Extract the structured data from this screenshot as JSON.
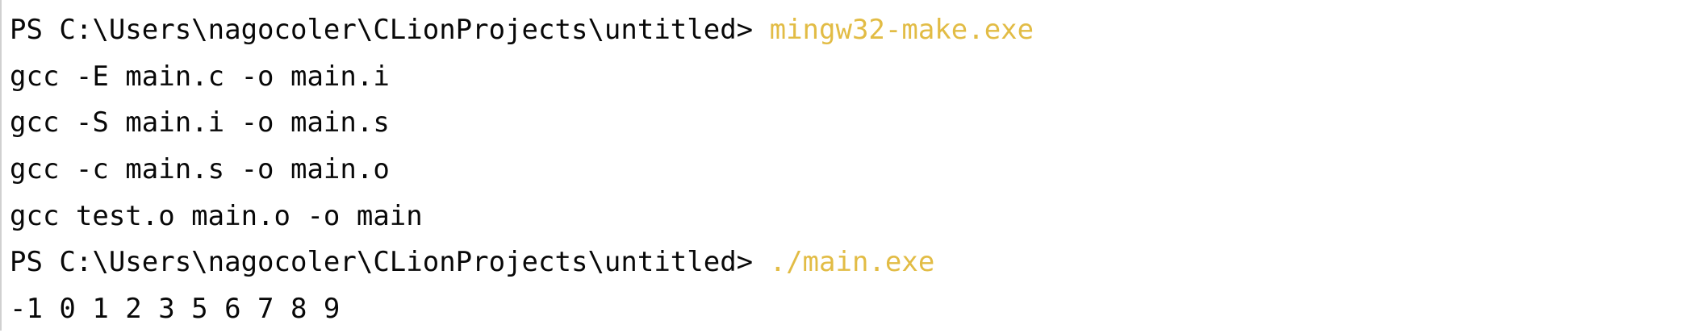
{
  "terminal": {
    "accent_color": "#e2bc45",
    "lines": [
      {
        "prompt": "PS C:\\Users\\nagocoler\\CLionProjects\\untitled> ",
        "command": "mingw32-make.exe"
      },
      {
        "output": "gcc -E main.c -o main.i"
      },
      {
        "output": "gcc -S main.i -o main.s"
      },
      {
        "output": "gcc -c main.s -o main.o"
      },
      {
        "output": "gcc test.o main.o -o main"
      },
      {
        "prompt": "PS C:\\Users\\nagocoler\\CLionProjects\\untitled> ",
        "command": "./main.exe"
      },
      {
        "output": "-1 0 1 2 3 5 6 7 8 9"
      }
    ]
  }
}
